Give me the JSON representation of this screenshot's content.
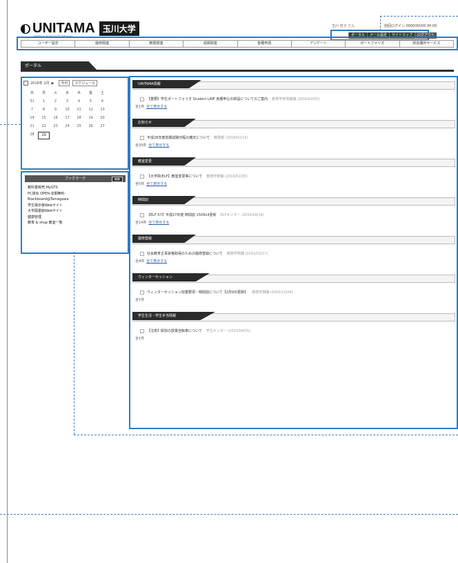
{
  "header": {
    "logo_text": "UNITAMA",
    "logo_kanji": "玉川大学",
    "logo_sub": "UNIVERSAL INFORMATION TAMAGAWA",
    "user_greeting": "玉川 花子 さん",
    "last_login": "前回ログイン 0000/00/00 00:00",
    "util_links": [
      "ポータル",
      "メール設定",
      "サイトマップ",
      "ログアウト"
    ]
  },
  "nav": [
    "ユーザー設定",
    "履修関連",
    "教務関連",
    "成績関連",
    "各種申請",
    "アンケート",
    "ポートフォリオ",
    "校友課外サービス"
  ],
  "portal_tab": "ポータル",
  "calendar": {
    "month_label": "2016年 2月",
    "prev": "◀",
    "next": "▶",
    "today_btn": "今日",
    "schedule_btn": "スケジュール",
    "dow": [
      "日",
      "月",
      "火",
      "水",
      "木",
      "金",
      "土"
    ],
    "rows": [
      [
        "31",
        "1",
        "2",
        "3",
        "4",
        "5",
        "6"
      ],
      [
        "7",
        "8",
        "9",
        "10",
        "11",
        "12",
        "13"
      ],
      [
        "14",
        "15",
        "16",
        "17",
        "18",
        "19",
        "20"
      ],
      [
        "21",
        "22",
        "23",
        "24",
        "25",
        "26",
        "27"
      ],
      [
        "28",
        "29",
        "",
        "",
        "",
        "",
        ""
      ]
    ],
    "today": "29"
  },
  "bookmark": {
    "title": "ブックマーク",
    "edit": "編集",
    "items": [
      "教科書販売 MyGTS",
      "PC貸出 OPEN-定期無料",
      "Blackboard@Tamagawa",
      "学生掲示板Webサイト",
      "大学図書館Webサイト",
      "健康管理",
      "教育 & shop 教室一覧"
    ]
  },
  "sections": [
    {
      "title": "UNITAMA情報",
      "item": "【重要】学生ポートフォリオ Student LINF 各種申込の新設についてのご案内",
      "meta": "教育学術情報課 (2016/02/01)",
      "count": "全1件",
      "all": "全て表示する"
    },
    {
      "title": "お知らせ",
      "item": "平成28年度前期試験日程の確定について",
      "meta": "教務部 (2016/02/15)",
      "count": "全20件",
      "all": "全て表示する"
    },
    {
      "title": "教室変更",
      "item": "【大学院/ELF】教室変更等について",
      "meta": "教務学務課 (2016/01/05)",
      "count": "全5件",
      "all": "全て表示する"
    },
    {
      "title": "時間割",
      "item": "【ELF-57】平成27年度 時間割 150914更新",
      "meta": "ELFセンター (2015/09/14)",
      "count": "全14件",
      "all": "全て表示する"
    },
    {
      "title": "履修登録",
      "item": "社会教育主事資格取得のための履修登録について",
      "meta": "教務学務課 (2015/03/17)",
      "count": "全4件",
      "all": "全て表示する"
    },
    {
      "title": "ウィンターセッション",
      "item": "ウィンターセッション授業要項・時間割について【2月9日更新】",
      "meta": "教務学務課 (2015/12/04)",
      "count": "全1件",
      "all": ""
    },
    {
      "title": "学生生活・学生手当情報",
      "item": "【注意】駅前の放置自転車について",
      "meta": "学生センター (2015/04/15)",
      "count": "全1件",
      "all": ""
    }
  ]
}
